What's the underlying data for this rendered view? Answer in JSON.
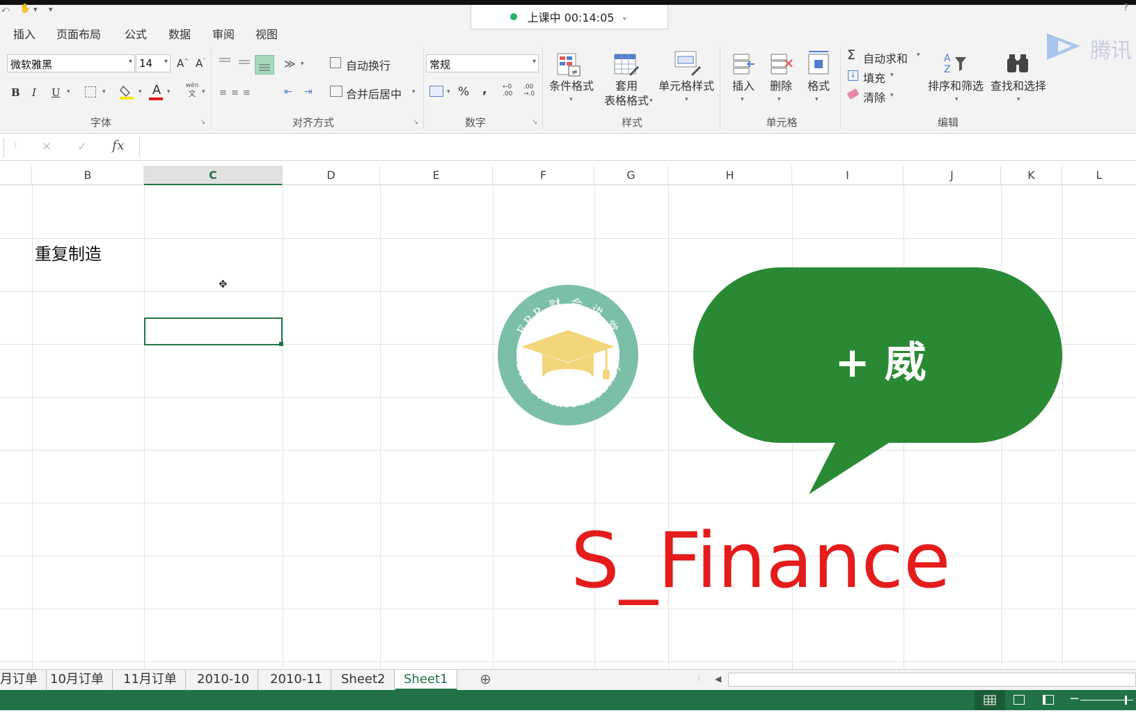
{
  "quick_access": {
    "dropdown_marker": "▾"
  },
  "menu": {
    "items": [
      "插入",
      "页面布局",
      "公式",
      "数据",
      "审阅",
      "视图"
    ]
  },
  "live_status": {
    "text": "上课中 00:14:05",
    "chevron": "⌄"
  },
  "watermark_logo": {
    "text": "腾讯"
  },
  "help_glyph": "?",
  "font_group": {
    "font_name": "微软雅黑",
    "font_size": "14",
    "label": "字体",
    "grow_a": "A",
    "shrink_a": "A",
    "bold": "B",
    "italic": "I",
    "underline": "U",
    "font_color_a": "A",
    "phonetic_top": "wén",
    "phonetic_bottom": "文"
  },
  "align_group": {
    "wrap_text": "自动换行",
    "merge_center": "合并后居中",
    "label": "对齐方式"
  },
  "number_group": {
    "format": "常规",
    "percent": "%",
    "comma": ",",
    "inc_top": "←0",
    "inc_bottom": ".00",
    "dec_top": ".00",
    "dec_bottom": "→.0",
    "label": "数字"
  },
  "styles_group": {
    "conditional": "条件格式",
    "table_line1": "套用",
    "table_line2": "表格格式",
    "cell_styles": "单元格样式",
    "label": "样式"
  },
  "cells_group": {
    "insert": "插入",
    "delete": "删除",
    "format": "格式",
    "label": "单元格"
  },
  "editing_group": {
    "autosum": "自动求和",
    "fill": "填充",
    "clear": "清除",
    "sort_filter": "排序和筛选",
    "find_select": "查找和选择",
    "label": "编辑"
  },
  "formula_bar": {
    "fx": "fx",
    "cancel": "✕",
    "confirm": "✓"
  },
  "columns": [
    "B",
    "C",
    "D",
    "E",
    "F",
    "G",
    "H",
    "I",
    "J",
    "K",
    "L"
  ],
  "active_column": "C",
  "cells": {
    "B2": "重复制造"
  },
  "logo": {
    "top_text": "ERP 财 会 讲 堂",
    "bottom_text": "ERP Finance Academy"
  },
  "bubble": {
    "text": "+ 威"
  },
  "brand": {
    "text": "S_Finance"
  },
  "sheet_tabs": [
    "月订单",
    "10月订单",
    "11月订单",
    "2010-10",
    "2010-11",
    "Sheet2",
    "Sheet1"
  ],
  "active_sheet": "Sheet1",
  "add_sheet": "⊕",
  "colors": {
    "excel_green": "#217346",
    "bubble_green": "#2a8a34",
    "brand_red": "#e41c1c",
    "logo_teal": "#7cbfa7",
    "logo_gold": "#f3d57a"
  }
}
